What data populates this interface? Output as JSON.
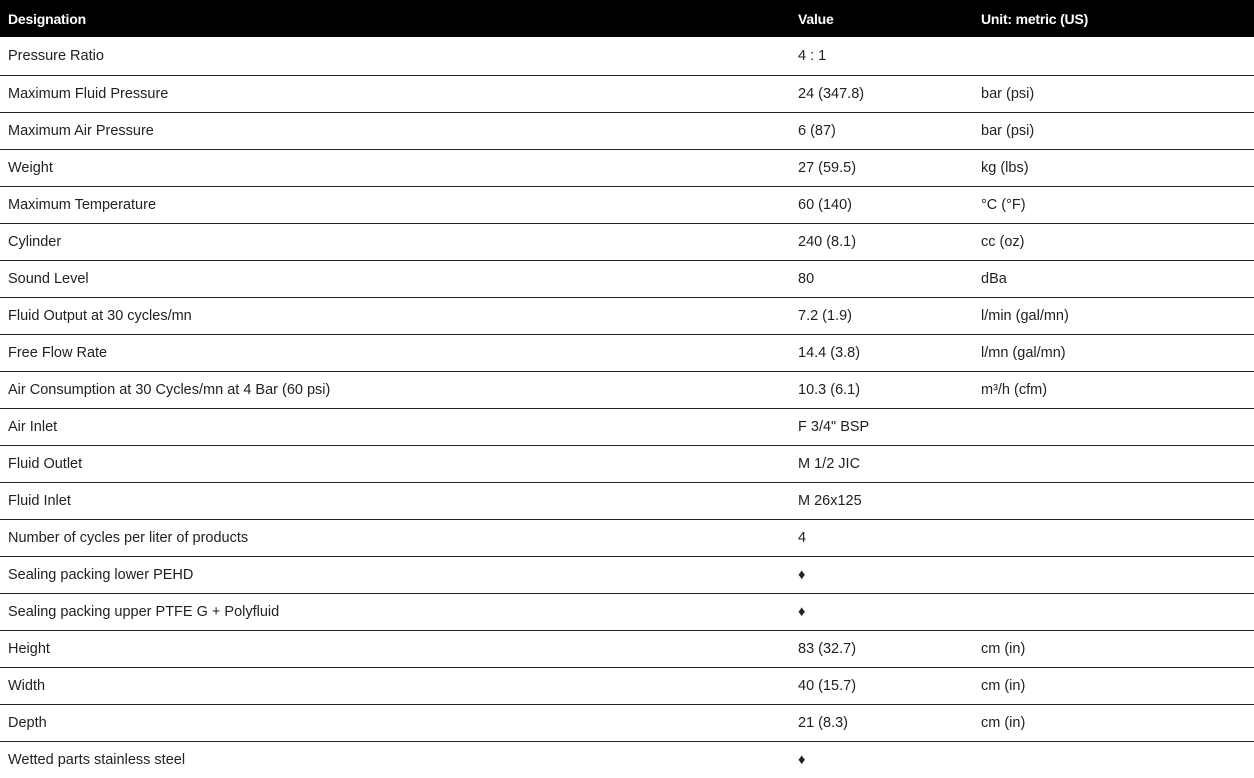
{
  "table": {
    "headers": {
      "designation": "Designation",
      "value": "Value",
      "unit": "Unit: metric (US)"
    },
    "rows": [
      {
        "designation": "Pressure Ratio",
        "value": "4 : 1",
        "unit": ""
      },
      {
        "designation": "Maximum Fluid Pressure",
        "value": "24 (347.8)",
        "unit": "bar (psi)"
      },
      {
        "designation": "Maximum Air Pressure",
        "value": "6 (87)",
        "unit": "bar (psi)"
      },
      {
        "designation": "Weight",
        "value": "27 (59.5)",
        "unit": "kg (lbs)"
      },
      {
        "designation": "Maximum Temperature",
        "value": "60 (140)",
        "unit": "°C (°F)"
      },
      {
        "designation": "Cylinder",
        "value": "240 (8.1)",
        "unit": "cc (oz)"
      },
      {
        "designation": "Sound Level",
        "value": "80",
        "unit": "dBa"
      },
      {
        "designation": "Fluid Output at 30 cycles/mn",
        "value": "7.2 (1.9)",
        "unit": "l/min (gal/mn)"
      },
      {
        "designation": "Free Flow Rate",
        "value": "14.4 (3.8)",
        "unit": "l/mn (gal/mn)"
      },
      {
        "designation": "Air Consumption at 30 Cycles/mn at 4 Bar (60 psi)",
        "value": "10.3 (6.1)",
        "unit": "m³/h (cfm)"
      },
      {
        "designation": "Air Inlet",
        "value": "F 3/4\" BSP",
        "unit": ""
      },
      {
        "designation": "Fluid Outlet",
        "value": "M 1/2 JIC",
        "unit": ""
      },
      {
        "designation": "Fluid Inlet",
        "value": "M 26x125",
        "unit": ""
      },
      {
        "designation": "Number of cycles per liter of products",
        "value": "4",
        "unit": ""
      },
      {
        "designation": "Sealing packing lower PEHD",
        "value": "♦",
        "unit": ""
      },
      {
        "designation": "Sealing packing upper PTFE G + Polyfluid",
        "value": "♦",
        "unit": ""
      },
      {
        "designation": "Height",
        "value": "83 (32.7)",
        "unit": "cm (in)"
      },
      {
        "designation": "Width",
        "value": "40 (15.7)",
        "unit": "cm (in)"
      },
      {
        "designation": "Depth",
        "value": "21 (8.3)",
        "unit": "cm (in)"
      },
      {
        "designation": "Wetted parts stainless steel",
        "value": "♦",
        "unit": ""
      }
    ]
  }
}
